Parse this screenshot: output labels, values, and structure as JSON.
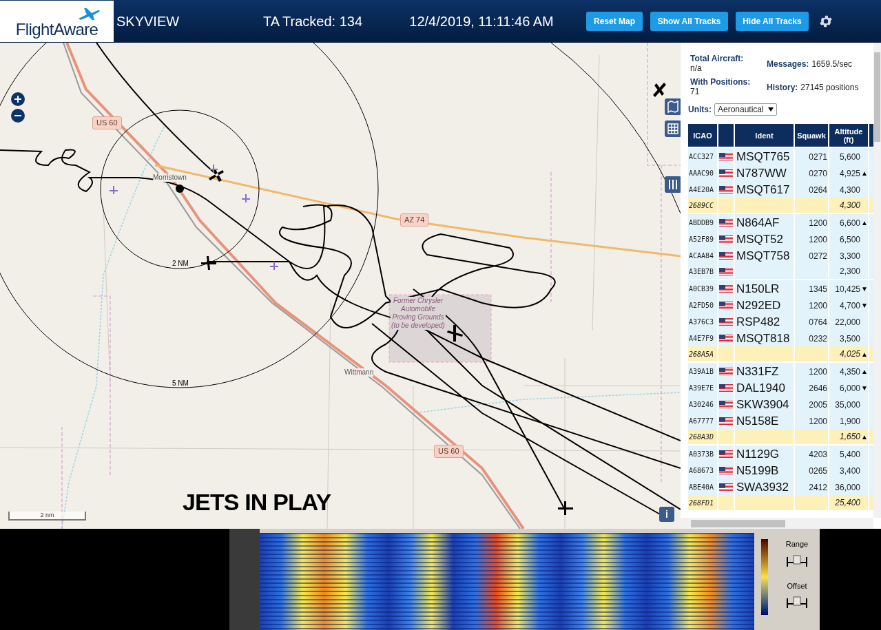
{
  "header": {
    "logo": "FlightAware",
    "title": "SKYVIEW",
    "tracked": "TA Tracked: 134",
    "datetime": "12/4/2019, 11:11:46 AM",
    "buttons": [
      "Reset Map",
      "Show All Tracks",
      "Hide All Tracks"
    ]
  },
  "map": {
    "labels": [
      {
        "kind": "shield",
        "text": "US 60"
      },
      {
        "kind": "shield",
        "text": "AZ 74"
      },
      {
        "kind": "shield",
        "text": "US 60"
      },
      {
        "kind": "town",
        "text": "Morristown"
      },
      {
        "kind": "town",
        "text": "Wittmann"
      },
      {
        "kind": "ring",
        "text": "2 NM"
      },
      {
        "kind": "ring",
        "text": "5 NM"
      },
      {
        "kind": "area",
        "text": "Former Chrysler Automobile Proving Grounds (to be developed)"
      }
    ],
    "scale": "2 nm",
    "overlay_text": "JETS IN PLAY",
    "info": "i"
  },
  "stats": [
    {
      "label": "Total Aircraft:",
      "value": "n/a"
    },
    {
      "label": "Messages:",
      "value": "1659.5/sec"
    },
    {
      "label": "With Positions:",
      "value": "71"
    },
    {
      "label": "History:",
      "value": "27145 positions"
    }
  ],
  "units": {
    "label": "Units:",
    "value": "Aeronautical"
  },
  "table": {
    "columns": [
      "ICAO",
      "",
      "Ident",
      "Squawk",
      "Altitude (ft)"
    ],
    "rows": [
      {
        "icao": "ACC327",
        "flag": true,
        "ident": "MSQT765",
        "squawk": "0271",
        "altitude": "5,600",
        "trend": "",
        "highlighted": false
      },
      {
        "icao": "AAAC90",
        "flag": true,
        "ident": "N787WW",
        "squawk": "0270",
        "altitude": "4,925",
        "trend": "▲",
        "highlighted": false
      },
      {
        "icao": "A4E20A",
        "flag": true,
        "ident": "MSQT617",
        "squawk": "0264",
        "altitude": "4,300",
        "trend": "",
        "highlighted": false
      },
      {
        "icao": "2689CC",
        "flag": false,
        "ident": "",
        "squawk": "",
        "altitude": "4,300",
        "trend": "",
        "highlighted": true
      },
      {
        "icao": "ABDDB9",
        "flag": true,
        "ident": "N864AF",
        "squawk": "1200",
        "altitude": "6,600",
        "trend": "▲",
        "highlighted": false
      },
      {
        "icao": "A52F89",
        "flag": true,
        "ident": "MSQT52",
        "squawk": "1200",
        "altitude": "6,500",
        "trend": "",
        "highlighted": false
      },
      {
        "icao": "ACAA84",
        "flag": true,
        "ident": "MSQT758",
        "squawk": "0272",
        "altitude": "3,300",
        "trend": "",
        "highlighted": false
      },
      {
        "icao": "A3EB7B",
        "flag": true,
        "ident": "",
        "squawk": "",
        "altitude": "2,300",
        "trend": "",
        "highlighted": false
      },
      {
        "icao": "A0CB39",
        "flag": true,
        "ident": "N150LR",
        "squawk": "1345",
        "altitude": "10,425",
        "trend": "▼",
        "highlighted": false
      },
      {
        "icao": "A2FD50",
        "flag": true,
        "ident": "N292ED",
        "squawk": "1200",
        "altitude": "4,700",
        "trend": "▼",
        "highlighted": false
      },
      {
        "icao": "A376C3",
        "flag": true,
        "ident": "RSP482",
        "squawk": "0764",
        "altitude": "22,000",
        "trend": "",
        "highlighted": false
      },
      {
        "icao": "A4E7F9",
        "flag": true,
        "ident": "MSQT818",
        "squawk": "0232",
        "altitude": "3,500",
        "trend": "",
        "highlighted": false
      },
      {
        "icao": "268A5A",
        "flag": false,
        "ident": "",
        "squawk": "",
        "altitude": "4,025",
        "trend": "▲",
        "highlighted": true
      },
      {
        "icao": "A39A1B",
        "flag": true,
        "ident": "N331FZ",
        "squawk": "1200",
        "altitude": "4,350",
        "trend": "▲",
        "highlighted": false
      },
      {
        "icao": "A39E7E",
        "flag": true,
        "ident": "DAL1940",
        "squawk": "2646",
        "altitude": "6,000",
        "trend": "▼",
        "highlighted": false
      },
      {
        "icao": "A30246",
        "flag": true,
        "ident": "SKW3904",
        "squawk": "2005",
        "altitude": "35,000",
        "trend": "",
        "highlighted": false
      },
      {
        "icao": "A67777",
        "flag": true,
        "ident": "N5158E",
        "squawk": "1200",
        "altitude": "1,900",
        "trend": "",
        "highlighted": false
      },
      {
        "icao": "268A3D",
        "flag": false,
        "ident": "",
        "squawk": "",
        "altitude": "1,650",
        "trend": "▲",
        "highlighted": true
      },
      {
        "icao": "A0373B",
        "flag": true,
        "ident": "N1129G",
        "squawk": "4203",
        "altitude": "5,400",
        "trend": "",
        "highlighted": false
      },
      {
        "icao": "A68673",
        "flag": true,
        "ident": "N5199B",
        "squawk": "0265",
        "altitude": "3,400",
        "trend": "",
        "highlighted": false
      },
      {
        "icao": "ABE40A",
        "flag": true,
        "ident": "SWA3932",
        "squawk": "2412",
        "altitude": "36,000",
        "trend": "",
        "highlighted": false
      },
      {
        "icao": "268FD1",
        "flag": false,
        "ident": "",
        "squawk": "",
        "altitude": "25,400",
        "trend": "",
        "highlighted": true
      }
    ]
  },
  "spectrum": {
    "controls": [
      "Range",
      "Offset"
    ]
  }
}
